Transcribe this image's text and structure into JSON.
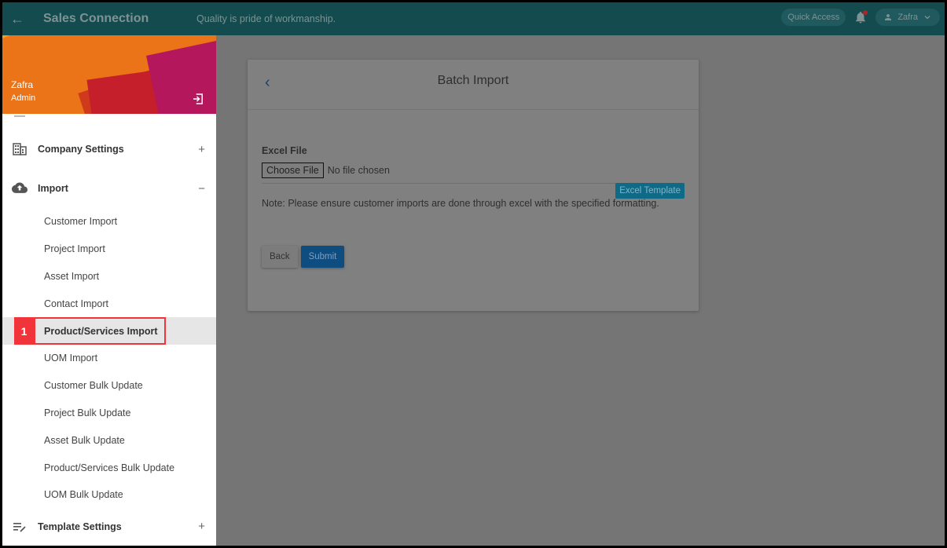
{
  "header": {
    "app_title": "Sales Connection",
    "tagline": "Quality is pride of workmanship.",
    "quick_access_label": "Quick Access",
    "user_name": "Zafra",
    "has_notification": true,
    "color": "#134b4f"
  },
  "sidebar": {
    "profile": {
      "name": "Zafra",
      "role": "Admin"
    },
    "groups": [
      {
        "label": "Company Settings",
        "icon": "building-icon",
        "toggle": "+"
      },
      {
        "label": "Import",
        "icon": "cloud-upload-icon",
        "toggle": "−",
        "items": [
          {
            "label": "Customer Import"
          },
          {
            "label": "Project Import"
          },
          {
            "label": "Asset Import"
          },
          {
            "label": "Contact Import"
          },
          {
            "label": "Product/Services Import",
            "active": true,
            "step": "1"
          },
          {
            "label": "UOM Import"
          },
          {
            "label": "Customer Bulk Update"
          },
          {
            "label": "Project Bulk Update"
          },
          {
            "label": "Asset Bulk Update"
          },
          {
            "label": "Product/Services Bulk Update"
          },
          {
            "label": "UOM Bulk Update"
          }
        ]
      },
      {
        "label": "Template Settings",
        "icon": "template-edit-icon",
        "toggle": "+"
      }
    ]
  },
  "main": {
    "card_title": "Batch Import",
    "field_label": "Excel File",
    "choose_file_label": "Choose File",
    "file_status": "No file chosen",
    "note": "Note: Please ensure customer imports are done through excel with the specified formatting.",
    "template_button": "Excel Template",
    "back_button": "Back",
    "submit_button": "Submit"
  },
  "annotation": {
    "step_number": "1",
    "color": "#f0343a"
  }
}
